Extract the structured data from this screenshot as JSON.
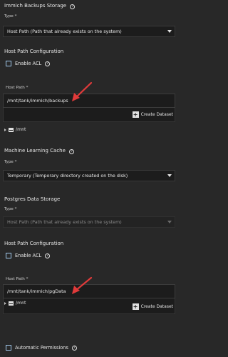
{
  "backups": {
    "title": "Immich Backups Storage",
    "type_label": "Type *",
    "type_value": "Host Path (Path that already exists on the system)",
    "hp_config_title": "Host Path Configuration",
    "enable_acl": "Enable ACL",
    "host_path_label": "Host Path *",
    "host_path_value": "/mnt/tank/immich/backups",
    "create_dataset": "Create Dataset",
    "tree_root": "/mnt"
  },
  "ml_cache": {
    "title": "Machine Learning Cache",
    "type_label": "Type *",
    "type_value": "Temporary (Temporary directory created on the disk)"
  },
  "postgres": {
    "title": "Postgres Data Storage",
    "type_label": "Type *",
    "type_value": "Host Path (Path that already exists on the system)",
    "hp_config_title": "Host Path Configuration",
    "enable_acl": "Enable ACL",
    "host_path_label": "Host Path *",
    "host_path_value": "/mnt/tank/immich/pgData",
    "create_dataset": "Create Dataset",
    "tree_root": "/mnt",
    "automatic_permissions": "Automatic Permissions"
  },
  "help_glyph": "?",
  "plus_glyph": "+",
  "colors": {
    "background": "#282828",
    "field": "#1c1c1c",
    "checkbox_border": "#9fc6e9",
    "annotation_arrow": "#e03a3a"
  }
}
